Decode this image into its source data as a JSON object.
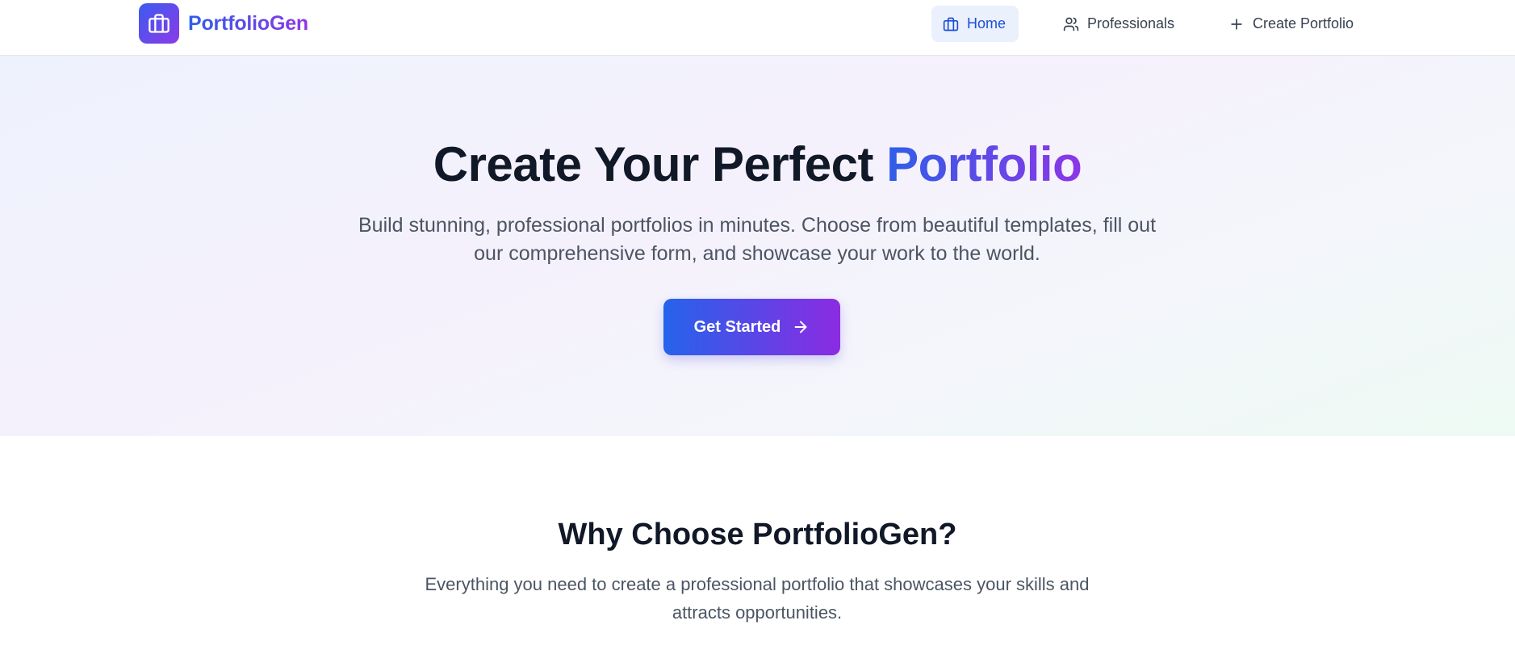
{
  "header": {
    "brand_name": "PortfolioGen",
    "brand_icon": "briefcase-icon",
    "nav": [
      {
        "label": "Home",
        "icon": "briefcase-icon",
        "active": true
      },
      {
        "label": "Professionals",
        "icon": "users-icon",
        "active": false
      },
      {
        "label": "Create Portfolio",
        "icon": "plus-icon",
        "active": false
      }
    ]
  },
  "hero": {
    "title_main": "Create Your Perfect",
    "title_accent": "Portfolio",
    "subtitle": "Build stunning, professional portfolios in minutes. Choose from beautiful templates, fill out our comprehensive form, and showcase your work to the world.",
    "cta_label": "Get Started",
    "cta_icon": "arrow-right-icon"
  },
  "why": {
    "title": "Why Choose PortfolioGen?",
    "subtitle": "Everything you need to create a professional portfolio that showcases your skills and attracts opportunities."
  },
  "colors": {
    "brand_gradient_start": "#2f5ee8",
    "brand_gradient_end": "#8d36e6",
    "active_nav_bg": "#eaf0fc",
    "active_nav_text": "#1d4ed8"
  }
}
